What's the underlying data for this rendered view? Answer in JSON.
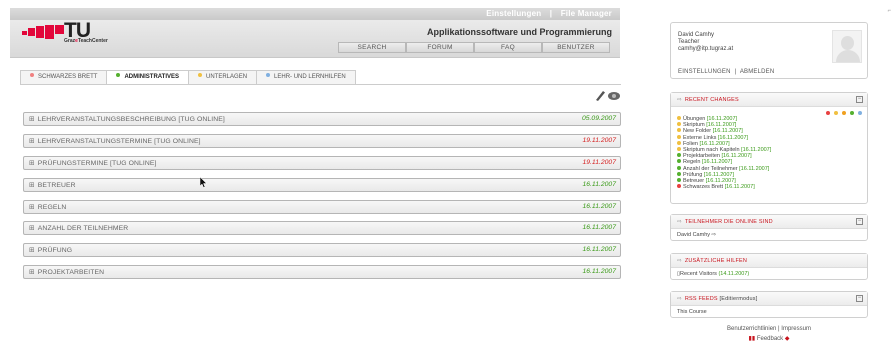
{
  "header": {
    "top_links": [
      "Einstellungen",
      "|",
      "File Manager"
    ],
    "logo_text": "TU",
    "logo_sub_prefix": "Graz",
    "logo_sub_accent": "e",
    "logo_sub_suffix": "TeachCenter",
    "app_title": "Applikationssoftware und Programmierung",
    "nav": [
      "SEARCH",
      "FORUM",
      "FAQ",
      "BENUTZER"
    ]
  },
  "tabs": [
    {
      "label": "SCHWARZES BRETT",
      "dot": "#f08080"
    },
    {
      "label": "ADMINISTRATIVES",
      "dot": "#55b02f",
      "active": true
    },
    {
      "label": "UNTERLAGEN",
      "dot": "#f0c040"
    },
    {
      "label": "LEHR- UND LERNHILFEN",
      "dot": "#80b0e0"
    }
  ],
  "rows": [
    {
      "label": "LEHRVERANSTALTUNGSBESCHREIBUNG [TUG ONLINE]",
      "date": "05.09.2007",
      "color": "green"
    },
    {
      "label": "LEHRVERANSTALTUNGSTERMINE [TUG ONLINE]",
      "date": "19.11.2007",
      "color": "red"
    },
    {
      "label": "PRÜFUNGSTERMINE [TUG ONLINE]",
      "date": "19.11.2007",
      "color": "red"
    },
    {
      "label": "BETREUER",
      "date": "16.11.2007",
      "color": "green"
    },
    {
      "label": "REGELN",
      "date": "16.11.2007",
      "color": "green"
    },
    {
      "label": "ANZAHL DER TEILNEHMER",
      "date": "16.11.2007",
      "color": "green"
    },
    {
      "label": "PRÜFUNG",
      "date": "16.11.2007",
      "color": "green"
    },
    {
      "label": "PROJEKTARBEITEN",
      "date": "16.11.2007",
      "color": "green"
    }
  ],
  "row_prefix": "⊞",
  "user": {
    "name": "David Camhy",
    "role": "Teacher",
    "email": "camhy@itp.tugraz.at",
    "settings": "EINSTELLUNGEN",
    "sep": "|",
    "logout": "ABMELDEN"
  },
  "recent": {
    "title": "RECENT CHANGES",
    "colors": [
      "#e84040",
      "#f0c040",
      "#f0a020",
      "#55b02f",
      "#80b0e0"
    ],
    "items": [
      {
        "name": "Übungen",
        "date": "[16.11.2007]",
        "dot": "#f0c040"
      },
      {
        "name": "Skriptum",
        "date": "[16.11.2007]",
        "dot": "#f0c040"
      },
      {
        "name": "New Folder",
        "date": "[16.11.2007]",
        "dot": "#f0c040"
      },
      {
        "name": "Externe Links",
        "date": "[16.11.2007]",
        "dot": "#f0c040"
      },
      {
        "name": "Folien",
        "date": "[16.11.2007]",
        "dot": "#f0c040"
      },
      {
        "name": "Skriptum nach Kapiteln",
        "date": "[16.11.2007]",
        "dot": "#f0c040"
      },
      {
        "name": "Projektarbeiten",
        "date": "[16.11.2007]",
        "dot": "#55b02f"
      },
      {
        "name": "Regeln",
        "date": "[16.11.2007]",
        "dot": "#55b02f"
      },
      {
        "name": "Anzahl der Teilnehmer",
        "date": "[16.11.2007]",
        "dot": "#55b02f"
      },
      {
        "name": "Prüfung",
        "date": "[16.11.2007]",
        "dot": "#55b02f"
      },
      {
        "name": "Betreuer",
        "date": "[16.11.2007]",
        "dot": "#55b02f"
      },
      {
        "name": "Schwarzes Brett",
        "date": "[16.11.2007]",
        "dot": "#e84040"
      }
    ]
  },
  "online": {
    "title": "TEILNEHMER DIE ONLINE SIND",
    "user": "David Camhy"
  },
  "help": {
    "title": "ZUSÄTZLICHE HILFEN",
    "item": "Recent Visitors",
    "date": "(14.11.2007)"
  },
  "rss": {
    "title": "RSS FEEDS",
    "mode": "[Editiermodus]",
    "item": "This Course"
  },
  "footer": {
    "links": "Benutzerrichtlinien | Impressum",
    "feedback": "Feedback"
  },
  "arrow_glyph": "⇨",
  "minimize_glyph": "−"
}
